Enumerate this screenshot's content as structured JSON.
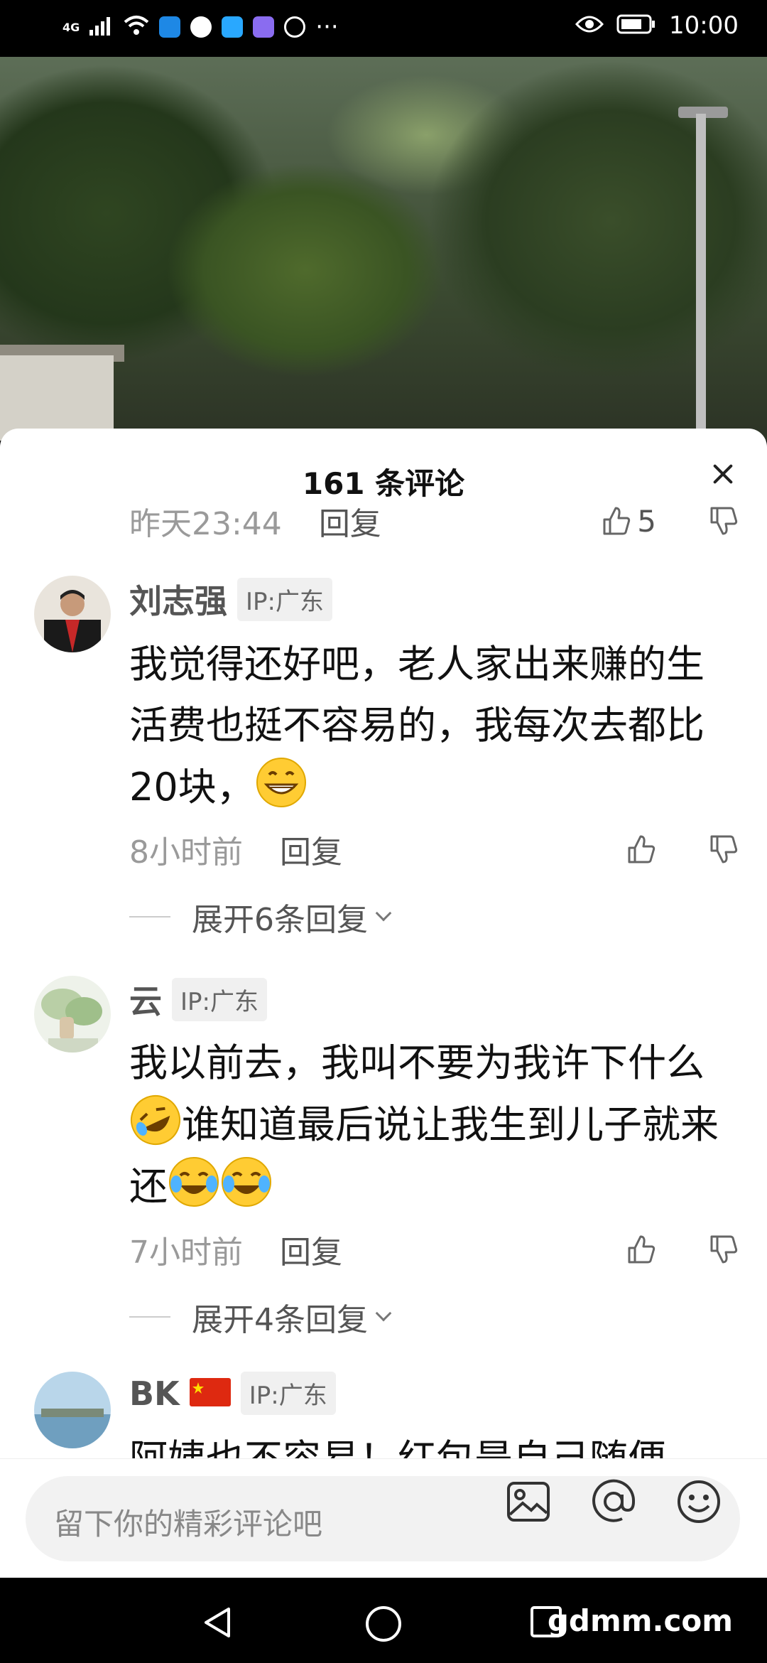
{
  "status_bar": {
    "network": "4G",
    "time": "10:00"
  },
  "sheet": {
    "title": "161 条评论"
  },
  "previous_comment_meta": {
    "time": "昨天23:44",
    "reply": "回复",
    "likes": "5"
  },
  "comments": [
    {
      "username": "刘志强",
      "ip": "IP:广东",
      "text": "我觉得还好吧，老人家出来赚的生活费也挺不容易的，我每次去都比20块，",
      "time": "8小时前",
      "reply": "回复",
      "expand": "展开6条回复"
    },
    {
      "username": "云",
      "ip": "IP:广东",
      "text_part1": "我以前去，我叫不要为我许下什么",
      "text_part2": "谁知道最后说让我生到儿子就来还",
      "time": "7小时前",
      "reply": "回复",
      "expand": "展开4条回复"
    },
    {
      "username": "BK",
      "ip": "IP:广东",
      "text": "阿姨也不容易！红包是自己随便"
    }
  ],
  "input_bar": {
    "placeholder": "留下你的精彩评论吧"
  },
  "nav": {
    "watermark": "gdmm.com"
  },
  "icons": [
    "wifi-icon",
    "signal-icon",
    "eye-icon",
    "battery-icon",
    "close-icon",
    "thumb-up-icon",
    "thumb-down-icon",
    "image-icon",
    "at-icon",
    "emoji-icon",
    "back-icon",
    "home-icon",
    "recents-icon"
  ]
}
